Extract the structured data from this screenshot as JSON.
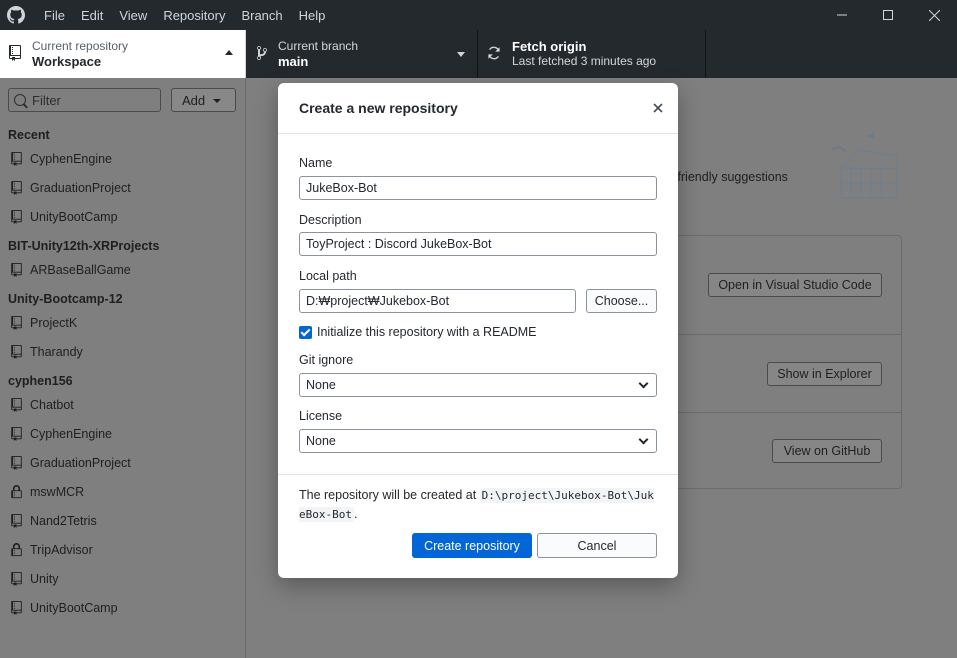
{
  "titlebar": {
    "menu": [
      "File",
      "Edit",
      "View",
      "Repository",
      "Branch",
      "Help"
    ]
  },
  "toolbar": {
    "repo": {
      "label": "Current repository",
      "value": "Workspace"
    },
    "branch": {
      "label": "Current branch",
      "value": "main"
    },
    "fetch": {
      "label": "Fetch origin",
      "sublabel": "Last fetched 3 minutes ago"
    }
  },
  "sidebar": {
    "filter_placeholder": "Filter",
    "add_label": "Add",
    "groups": [
      {
        "name": "Recent",
        "items": [
          {
            "label": "CyphenEngine",
            "icon": "repo-icon"
          },
          {
            "label": "GraduationProject",
            "icon": "repo-icon"
          },
          {
            "label": "UnityBootCamp",
            "icon": "repo-icon"
          }
        ]
      },
      {
        "name": "BIT-Unity12th-XRProjects",
        "items": [
          {
            "label": "ARBaseBallGame",
            "icon": "repo-icon"
          }
        ]
      },
      {
        "name": "Unity-Bootcamp-12",
        "items": [
          {
            "label": "ProjectK",
            "icon": "repo-icon"
          },
          {
            "label": "Tharandy",
            "icon": "repo-icon"
          }
        ]
      },
      {
        "name": "cyphen156",
        "items": [
          {
            "label": "Chatbot",
            "icon": "repo-icon"
          },
          {
            "label": "CyphenEngine",
            "icon": "repo-icon"
          },
          {
            "label": "GraduationProject",
            "icon": "repo-icon"
          },
          {
            "label": "mswMCR",
            "icon": "lock-icon"
          },
          {
            "label": "Nand2Tetris",
            "icon": "repo-icon"
          },
          {
            "label": "TripAdvisor",
            "icon": "lock-icon"
          },
          {
            "label": "Unity",
            "icon": "repo-icon"
          },
          {
            "label": "UnityBootCamp",
            "icon": "repo-icon"
          }
        ]
      }
    ]
  },
  "main": {
    "hint_text": "e friendly suggestions",
    "actions": [
      "Open in Visual Studio Code",
      "Show in Explorer",
      "View on GitHub"
    ]
  },
  "dialog": {
    "title": "Create a new repository",
    "name_label": "Name",
    "name_value": "JukeBox-Bot",
    "description_label": "Description",
    "description_value": "ToyProject : Discord JukeBox-Bot",
    "path_label": "Local path",
    "path_value": "D:₩project₩Jukebox-Bot",
    "choose_label": "Choose...",
    "readme_label": "Initialize this repository with a README",
    "readme_checked": true,
    "gitignore_label": "Git ignore",
    "gitignore_value": "None",
    "license_label": "License",
    "license_value": "None",
    "note_prefix": "The repository will be created at",
    "note_path": "D:\\project\\Jukebox-Bot\\JukeBox-Bot",
    "note_suffix": ".",
    "create_label": "Create repository",
    "cancel_label": "Cancel"
  },
  "colors": {
    "accent": "#0366d6",
    "titlebar_bg": "#24292e",
    "overlay": "#7f7f7f"
  }
}
